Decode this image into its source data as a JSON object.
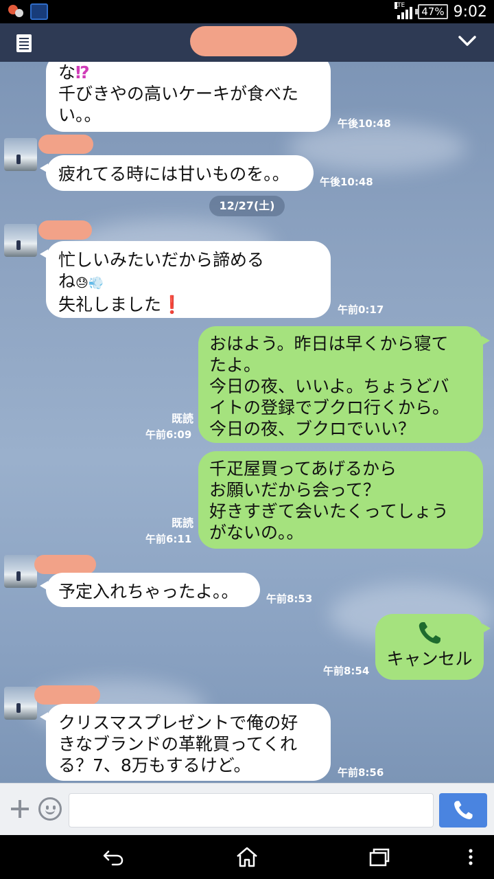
{
  "status_bar": {
    "network_label": "LTE",
    "battery_text": "47%",
    "clock": "9:02"
  },
  "header": {
    "menu_icon": "list-icon",
    "collapse_icon": "chevron-down-icon",
    "title_redacted": true
  },
  "messages": [
    {
      "side": "in",
      "lines": [
        "な",
        "千びきやの高いケーキが食べた",
        "い。。"
      ],
      "mark": "⁉",
      "time": "午後10:48"
    },
    {
      "side": "in",
      "lines": [
        "疲れてる時には甘いものを。。"
      ],
      "time": "午後10:48"
    },
    {
      "type": "date",
      "label": "12/27(土)"
    },
    {
      "side": "in",
      "lines": [
        "忙しいみたいだから諦める",
        "ね",
        "失礼しました"
      ],
      "emoji": "😓💨",
      "mark": "❗",
      "time": "午前0:17"
    },
    {
      "side": "out",
      "lines": [
        "おはよう。昨日は早くから寝て",
        "たよ。",
        "今日の夜、いいよ。ちょうどバ",
        "イトの登録でブクロ行くから。",
        "今日の夜、ブクロでいい？"
      ],
      "read": "既読",
      "time": "午前6:09"
    },
    {
      "side": "out",
      "lines": [
        "千疋屋買ってあげるから",
        "お願いだから会って？",
        "好きすぎて会いたくってしょう",
        "がないの。。"
      ],
      "read": "既読",
      "time": "午前6:11"
    },
    {
      "side": "in",
      "lines": [
        "予定入れちゃったよ。。"
      ],
      "time": "午前8:53"
    },
    {
      "side": "out",
      "call": true,
      "lines": [
        "キャンセル"
      ],
      "icon": "phone-icon",
      "time": "午前8:54"
    },
    {
      "side": "in",
      "lines": [
        "クリスマスプレゼントで俺の好",
        "きなブランドの革靴買ってくれ",
        "る？7、8万もするけど。"
      ],
      "time": "午前8:56"
    }
  ],
  "input_bar": {
    "plus_icon": "plus-icon",
    "emoji_icon": "smiley-icon",
    "text_value": "",
    "call_icon": "phone-icon",
    "send_color": "#4a84e0"
  },
  "nav_bar": {
    "back_icon": "back-icon",
    "home_icon": "home-icon",
    "recents_icon": "recents-icon",
    "menu_icon": "overflow-menu-icon"
  },
  "colors": {
    "header_bg": "#2e3a54",
    "incoming_bubble": "#ffffff",
    "outgoing_bubble": "#a5e27e",
    "redaction": "#f2a288"
  }
}
